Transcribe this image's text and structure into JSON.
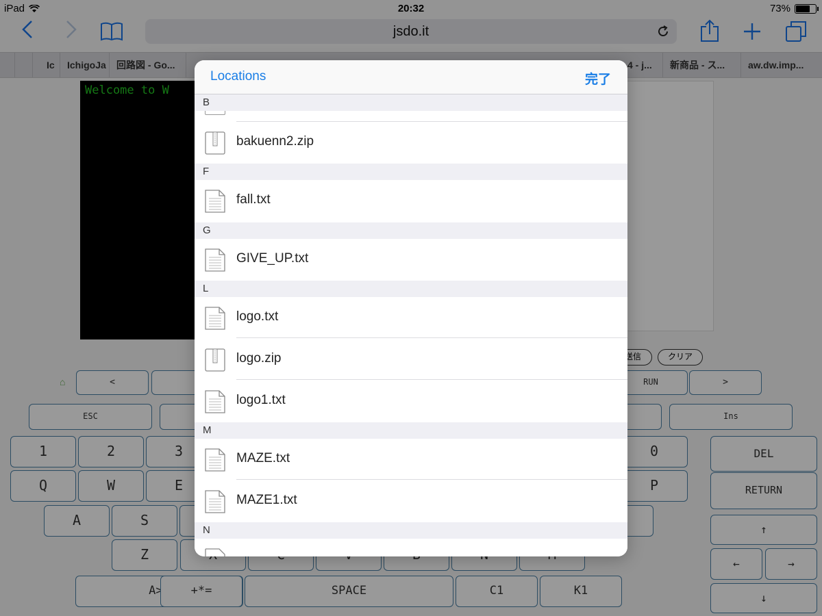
{
  "status_bar": {
    "device": "iPad",
    "time": "20:32",
    "battery": "73%"
  },
  "browser": {
    "url": "jsdo.it",
    "tabs": [
      "Ic",
      "IchigoJa",
      "回路図 - Go...",
      "4 - j...",
      "新商品 - ス...",
      "aw.dw.imp..."
    ]
  },
  "terminal": {
    "text": "Welcome to W"
  },
  "page_buttons": {
    "send": "送信",
    "clear": "クリア"
  },
  "keyboard": {
    "row0": {
      "left": "<",
      "run": "RUN",
      "right": ">"
    },
    "row1": {
      "esc": "ESC",
      "ins": "Ins"
    },
    "row2": [
      "1",
      "2",
      "3",
      "0"
    ],
    "row3": [
      "Q",
      "W",
      "E",
      "P"
    ],
    "row4": [
      "A",
      "S"
    ],
    "row5": [
      "Z",
      "X",
      "C",
      "V",
      "B",
      "N",
      "M"
    ],
    "row6": {
      "case": "A>a",
      "sym": "+*=",
      "space": "SPACE",
      "c1": "C1",
      "k1": "K1"
    },
    "side": {
      "del": "DEL",
      "return": "RETURN",
      "up": "↑",
      "left": "←",
      "right": "→",
      "down": "↓"
    }
  },
  "popover": {
    "title": "Locations",
    "done": "完了",
    "sections": [
      {
        "letter": "B",
        "files": [
          {
            "name": "bakuenn2.zip",
            "type": "zip"
          }
        ]
      },
      {
        "letter": "F",
        "files": [
          {
            "name": "fall.txt",
            "type": "txt"
          }
        ]
      },
      {
        "letter": "G",
        "files": [
          {
            "name": "GIVE_UP.txt",
            "type": "txt"
          }
        ]
      },
      {
        "letter": "L",
        "files": [
          {
            "name": "logo.txt",
            "type": "txt"
          },
          {
            "name": "logo.zip",
            "type": "zip"
          },
          {
            "name": "logo1.txt",
            "type": "txt"
          }
        ]
      },
      {
        "letter": "M",
        "files": [
          {
            "name": "MAZE.txt",
            "type": "txt"
          },
          {
            "name": "MAZE1.txt",
            "type": "txt"
          }
        ]
      },
      {
        "letter": "N",
        "files": []
      }
    ]
  },
  "colors": {
    "accent": "#1a7ee6",
    "terminal_text": "#23c623",
    "key_border": "#4a7fa5"
  }
}
